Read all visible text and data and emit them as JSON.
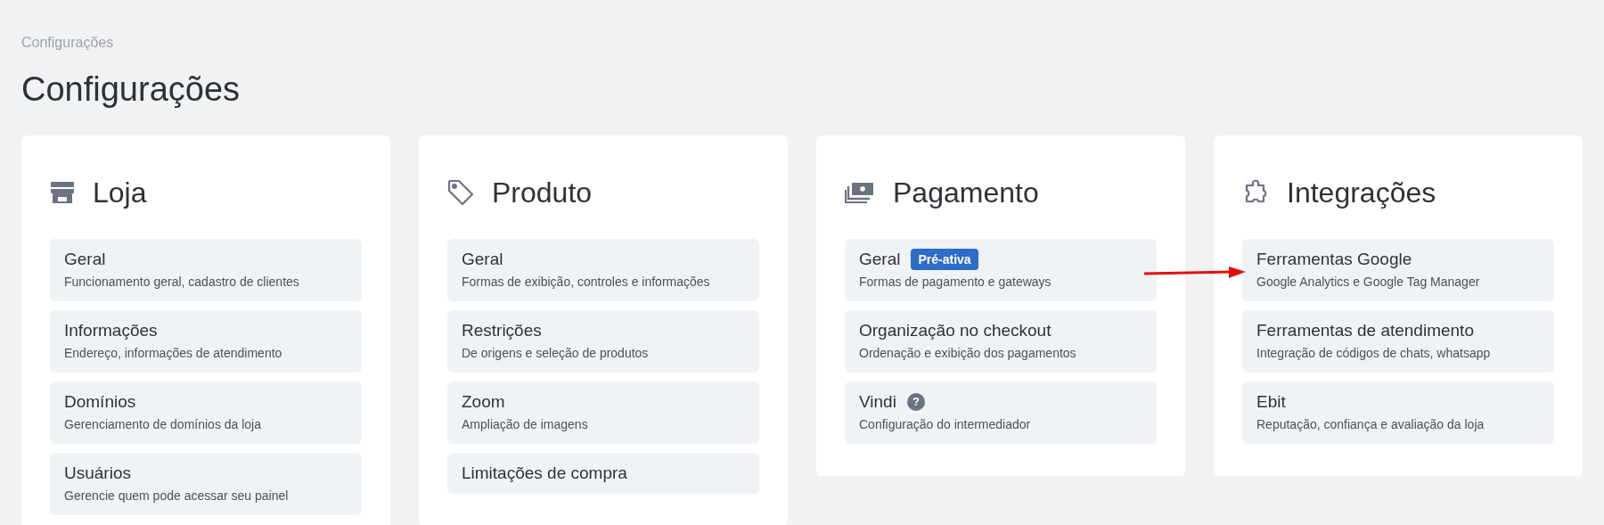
{
  "breadcrumb": "Configurações",
  "title": "Configurações",
  "sections": [
    {
      "title": "Loja",
      "items": [
        {
          "title": "Geral",
          "description": "Funcionamento geral, cadastro de clientes"
        },
        {
          "title": "Informações",
          "description": "Endereço, informações de atendimento"
        },
        {
          "title": "Domínios",
          "description": "Gerenciamento de domínios da loja"
        },
        {
          "title": "Usuários",
          "description": "Gerencie quem pode acessar seu painel"
        }
      ]
    },
    {
      "title": "Produto",
      "items": [
        {
          "title": "Geral",
          "description": "Formas de exibição, controles e informações"
        },
        {
          "title": "Restrições",
          "description": "De origens e seleção de produtos"
        },
        {
          "title": "Zoom",
          "description": "Ampliação de imagens"
        },
        {
          "title": "Limitações de compra"
        }
      ]
    },
    {
      "title": "Pagamento",
      "items": [
        {
          "title": "Geral",
          "badge": "Pré-ativa",
          "description": "Formas de pagamento e gateways"
        },
        {
          "title": "Organização no checkout",
          "description": "Ordenação e exibição dos pagamentos"
        },
        {
          "title": "Vindi",
          "help": "?",
          "description": "Configuração do intermediador"
        }
      ]
    },
    {
      "title": "Integrações",
      "items": [
        {
          "title": "Ferramentas Google",
          "description": "Google Analytics e Google Tag Manager"
        },
        {
          "title": "Ferramentas de atendimento",
          "description": "Integração de códigos de chats, whatsapp"
        },
        {
          "title": "Ebit",
          "description": "Reputação, confiança e avaliação da loja"
        }
      ]
    }
  ]
}
